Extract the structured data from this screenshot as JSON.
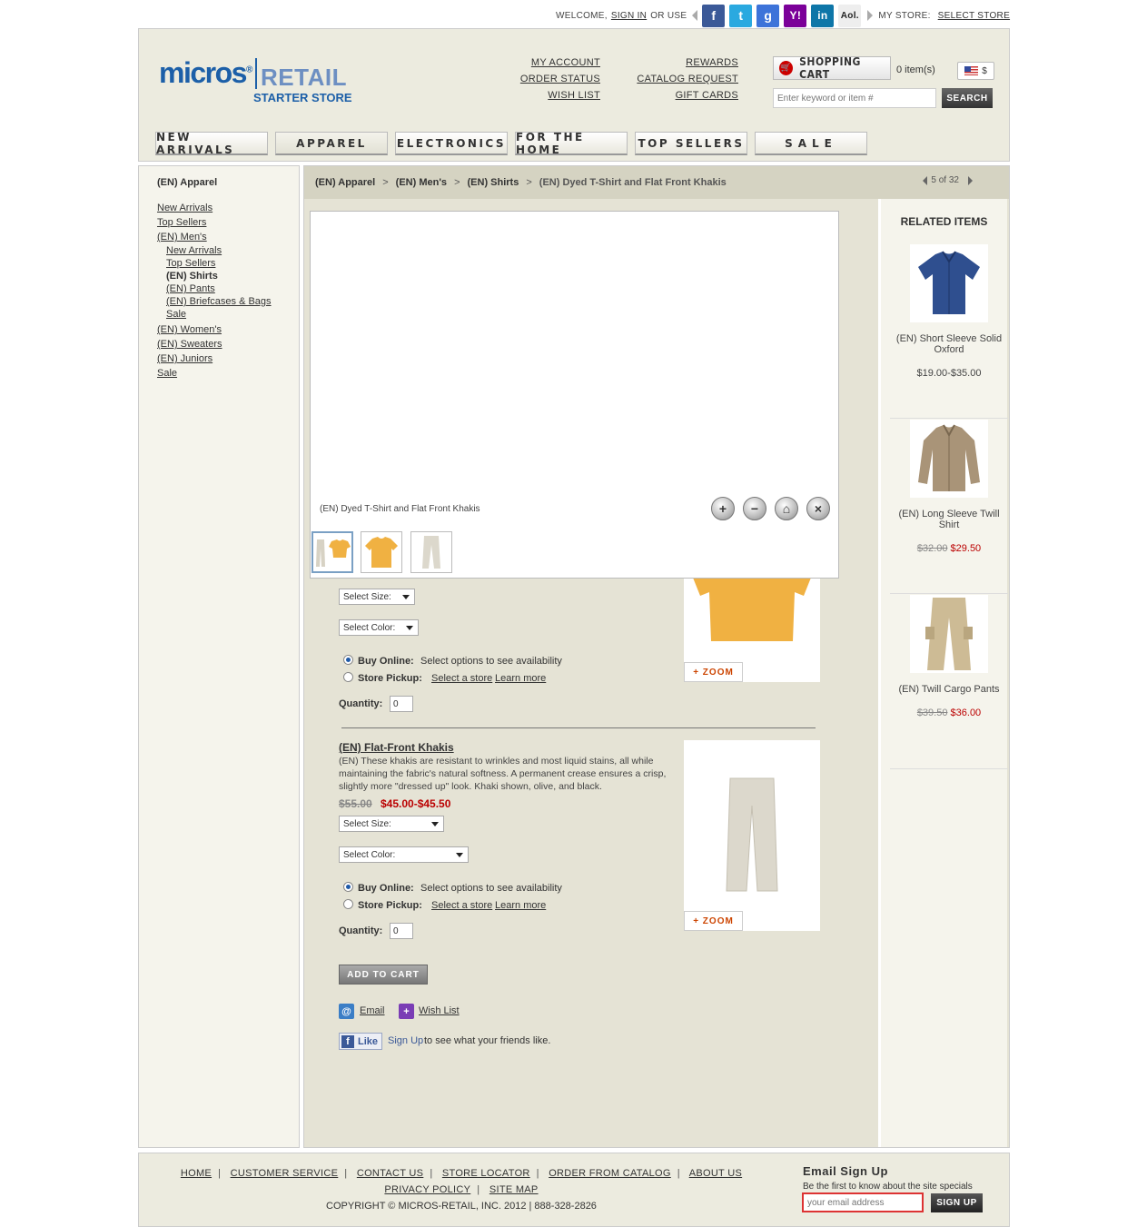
{
  "topbar": {
    "welcome": "WELCOME,",
    "sign_in": "SIGN IN",
    "or_use": "OR USE",
    "social": [
      {
        "name": "facebook",
        "glyph": "f",
        "color": "#3b5998"
      },
      {
        "name": "twitter",
        "glyph": "t",
        "color": "#2aa9e0"
      },
      {
        "name": "google",
        "glyph": "g",
        "color": "#3d73d9"
      },
      {
        "name": "yahoo",
        "glyph": "Y!",
        "color": "#7b0099"
      },
      {
        "name": "linkedin",
        "glyph": "in",
        "color": "#0e76a8"
      },
      {
        "name": "aol",
        "glyph": "Aol.",
        "color": "#eeeeee"
      }
    ],
    "my_store": "MY STORE:",
    "select_store": "SELECT STORE"
  },
  "header": {
    "logo_micros": "micros",
    "logo_reg": "®",
    "logo_retail": "RETAIL",
    "logo_sub": "STARTER STORE",
    "links_col1": [
      "MY ACCOUNT",
      "ORDER STATUS",
      "WISH LIST"
    ],
    "links_col2": [
      "REWARDS",
      "CATALOG REQUEST",
      "GIFT CARDS"
    ],
    "cart_label": "SHOPPING CART",
    "cart_count": "0 item(s)",
    "currency": "$",
    "search_placeholder": "Enter keyword or item #",
    "search_button": "SEARCH"
  },
  "nav": {
    "tabs": [
      "NEW ARRIVALS",
      "APPAREL",
      "ELECTRONICS",
      "FOR THE HOME",
      "TOP SELLERS",
      "SALE"
    ]
  },
  "sidebar": {
    "title": "(EN) Apparel",
    "items": [
      "New Arrivals",
      "Top Sellers",
      "(EN) Men's"
    ],
    "sub_items": [
      "New Arrivals",
      "Top Sellers",
      "(EN) Shirts",
      "(EN) Pants",
      "(EN) Briefcases & Bags",
      "Sale"
    ],
    "items_after": [
      "(EN) Women's",
      "(EN) Sweaters",
      "(EN) Juniors",
      "Sale"
    ]
  },
  "breadcrumb": {
    "items": [
      "(EN) Apparel",
      "(EN) Men's",
      "(EN) Shirts",
      "(EN) Dyed T-Shirt and Flat Front Khakis"
    ],
    "separator": ">",
    "pager": "5 of 32"
  },
  "viewer": {
    "caption": "(EN) Dyed T-Shirt and Flat Front Khakis",
    "controls": [
      "zoom-in",
      "zoom-out",
      "home",
      "close"
    ],
    "control_glyphs": [
      "+",
      "−",
      "⌂",
      "×"
    ],
    "thumbs": [
      "outfit",
      "t-shirt",
      "khakis"
    ]
  },
  "product1": {
    "size_label": "Select Size:",
    "color_label": "Select Color:",
    "buy_online": "Buy Online:",
    "buy_online_note": "Select options to see availability",
    "store_pickup": "Store Pickup:",
    "select_store": "Select a store",
    "learn_more": "Learn more",
    "quantity_label": "Quantity:",
    "quantity": "0",
    "zoom": "+ ZOOM"
  },
  "product2": {
    "title": "(EN) Flat-Front Khakis",
    "description": "(EN) These khakis are resistant to wrinkles and most liquid stains, all while maintaining the fabric's natural softness. A permanent crease ensures a crisp, slightly more \"dressed up\" look. Khaki shown, olive, and black.",
    "was": "$55.00",
    "now": "$45.00-$45.50",
    "size_label": "Select Size:",
    "color_label": "Select Color:",
    "buy_online": "Buy Online:",
    "buy_online_note": "Select options to see availability",
    "store_pickup": "Store Pickup:",
    "select_store": "Select a store",
    "learn_more": "Learn more",
    "quantity_label": "Quantity:",
    "quantity": "0",
    "zoom": "+ ZOOM"
  },
  "actions": {
    "add_to_cart": "ADD TO CART",
    "email": "Email",
    "wish_list": "Wish List",
    "like": "Like",
    "sign_up": "Sign Up",
    "friends_text": "to see what your friends like."
  },
  "related": {
    "title": "RELATED ITEMS",
    "items": [
      {
        "name": "(EN) Short Sleeve Solid Oxford",
        "price": "$19.00-$35.00",
        "was": "",
        "now": ""
      },
      {
        "name": "(EN) Long Sleeve Twill Shirt",
        "price": "",
        "was": "$32.00",
        "now": "$29.50"
      },
      {
        "name": "(EN) Twill Cargo Pants",
        "price": "",
        "was": "$39.50",
        "now": "$36.00"
      }
    ]
  },
  "footer": {
    "links_row1": [
      "HOME",
      "CUSTOMER SERVICE",
      "CONTACT US",
      "STORE LOCATOR",
      "ORDER FROM CATALOG",
      "ABOUT US"
    ],
    "links_row2": [
      "PRIVACY POLICY",
      "SITE MAP"
    ],
    "copyright": "COPYRIGHT © MICROS-RETAIL, INC. 2012 | 888-328-2826",
    "email_title": "Email Sign Up",
    "email_sub": "Be the first to know about the site specials",
    "email_placeholder": "your email address",
    "email_button": "SIGN UP"
  },
  "colors": {
    "brand_blue": "#1c5fa8",
    "sale_red": "#b00000",
    "header_bg": "#ecebdf",
    "main_bg": "#e5e3d5"
  }
}
